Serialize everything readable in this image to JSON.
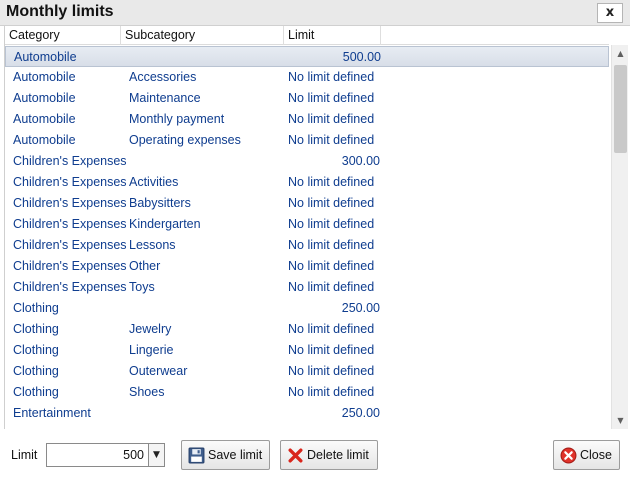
{
  "window": {
    "title": "Monthly limits",
    "close_glyph": "x"
  },
  "grid": {
    "columns": [
      "Category",
      "Subcategory",
      "Limit"
    ],
    "rows": [
      {
        "category": "Automobile",
        "subcategory": "",
        "limit": "500.00",
        "selected": true
      },
      {
        "category": "Automobile",
        "subcategory": "Accessories",
        "limit": "No limit defined"
      },
      {
        "category": "Automobile",
        "subcategory": "Maintenance",
        "limit": "No limit defined"
      },
      {
        "category": "Automobile",
        "subcategory": "Monthly payment",
        "limit": "No limit defined"
      },
      {
        "category": "Automobile",
        "subcategory": "Operating expenses",
        "limit": "No limit defined"
      },
      {
        "category": "Children's Expenses",
        "subcategory": "",
        "limit": "300.00"
      },
      {
        "category": "Children's Expenses",
        "subcategory": "Activities",
        "limit": "No limit defined"
      },
      {
        "category": "Children's Expenses",
        "subcategory": "Babysitters",
        "limit": "No limit defined"
      },
      {
        "category": "Children's Expenses",
        "subcategory": "Kindergarten",
        "limit": "No limit defined"
      },
      {
        "category": "Children's Expenses",
        "subcategory": "Lessons",
        "limit": "No limit defined"
      },
      {
        "category": "Children's Expenses",
        "subcategory": "Other",
        "limit": "No limit defined"
      },
      {
        "category": "Children's Expenses",
        "subcategory": "Toys",
        "limit": "No limit defined"
      },
      {
        "category": "Clothing",
        "subcategory": "",
        "limit": "250.00"
      },
      {
        "category": "Clothing",
        "subcategory": "Jewelry",
        "limit": "No limit defined"
      },
      {
        "category": "Clothing",
        "subcategory": "Lingerie",
        "limit": "No limit defined"
      },
      {
        "category": "Clothing",
        "subcategory": "Outerwear",
        "limit": "No limit defined"
      },
      {
        "category": "Clothing",
        "subcategory": "Shoes",
        "limit": "No limit defined"
      },
      {
        "category": "Entertainment",
        "subcategory": "",
        "limit": "250.00"
      }
    ]
  },
  "footer": {
    "limit_label": "Limit",
    "limit_value": "500",
    "save_label": "Save limit",
    "delete_label": "Delete limit",
    "close_label": "Close"
  },
  "icons": {
    "save": "floppy-disk-icon",
    "delete": "red-x-icon",
    "close": "red-circle-x-icon",
    "dropdown": "chevron-down-icon"
  },
  "colors": {
    "row_text": "#0f3d8f",
    "selected_row": "#dde3ec",
    "delete_red": "#d9261c"
  }
}
